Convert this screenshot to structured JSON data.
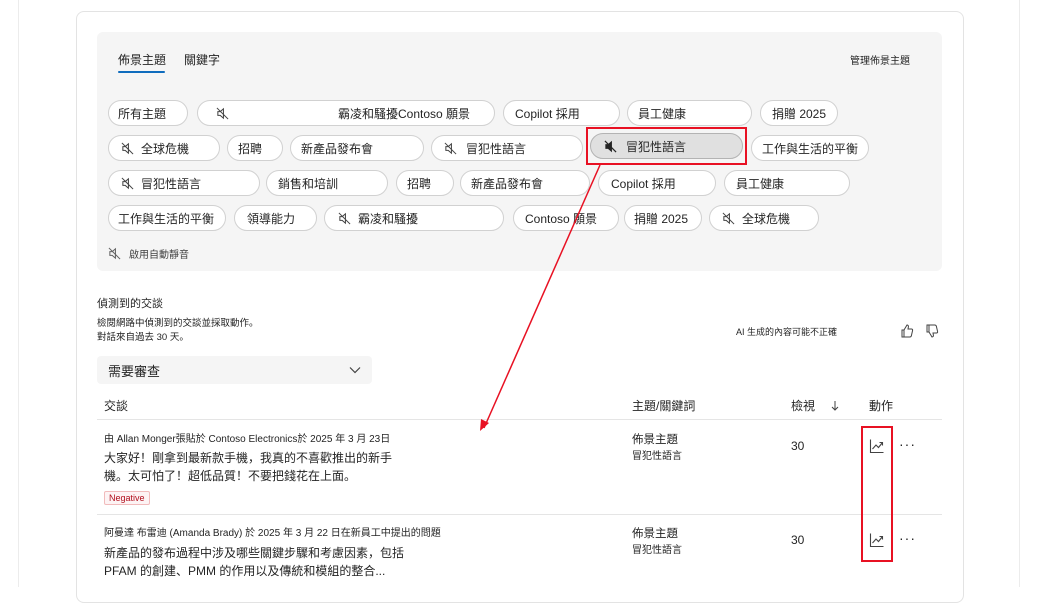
{
  "tabs": [
    {
      "label": "佈景主題",
      "active": true
    },
    {
      "label": "關鍵字",
      "active": false
    }
  ],
  "manage_topics_label": "管理佈景主題",
  "pills": {
    "r1": [
      "所有主題",
      "霸凌和騷擾Contoso 願景",
      "Copilot 採用",
      "員工健康",
      "捐贈 2025"
    ],
    "r2": [
      "全球危機",
      "招聘",
      "新產品發布會",
      "冒犯性語言",
      "冒犯性語言",
      "工作與生活的平衡"
    ],
    "r3": [
      "冒犯性語言",
      "銷售和培訓",
      "招聘",
      "新產品發布會",
      "Copilot 採用",
      "員工健康"
    ],
    "r4": [
      "工作與生活的平衡",
      "領導能力",
      "霸凌和騷擾",
      "Contoso 願景",
      "捐贈 2025",
      "全球危機"
    ]
  },
  "auto_mute_label": "啟用自動靜音",
  "section": {
    "title": "偵測到的交談",
    "desc1": "檢閱網路中偵測到的交談並採取動作。",
    "desc2": "對話來自過去 30 天。",
    "ai_note": "AI 生成的內容可能不正確"
  },
  "filter": {
    "selected": "需要審查"
  },
  "table": {
    "headers": {
      "conversation": "交談",
      "topic": "主題/關鍵詞",
      "views": "檢視",
      "action": "動作"
    },
    "rows": [
      {
        "meta": "由 Allan Monger張貼於 Contoso Electronics於 2025 年 3 月 23日",
        "line1": "大家好！剛拿到最新款手機，我真的不喜歡推出的新手",
        "line2": "機。太可怕了！超低品質！不要把錢花在上面。",
        "badge": "Negative",
        "topic": "佈景主題",
        "keyword": "冒犯性語言",
        "views": "30"
      },
      {
        "meta": "阿曼達 布雷迪 (Amanda Brady) 於 2025 年 3 月 22 日在新員工中提出的問題",
        "line1": "新產品的發布過程中涉及哪些關鍵步驟和考慮因素，包括",
        "line2": "PFAM 的創建、PMM 的作用以及傳統和模組的整合...",
        "topic": "佈景主題",
        "keyword": "冒犯性語言",
        "views": "30"
      }
    ]
  },
  "colors": {
    "accent": "#0f6cbd",
    "highlight": "#e81123",
    "negative": "#b10e1c"
  },
  "icons": [
    "mute-icon",
    "thumbs-up-icon",
    "thumbs-down-icon",
    "chevron-down-icon",
    "sort-arrow-icon",
    "trend-icon",
    "more-icon"
  ]
}
